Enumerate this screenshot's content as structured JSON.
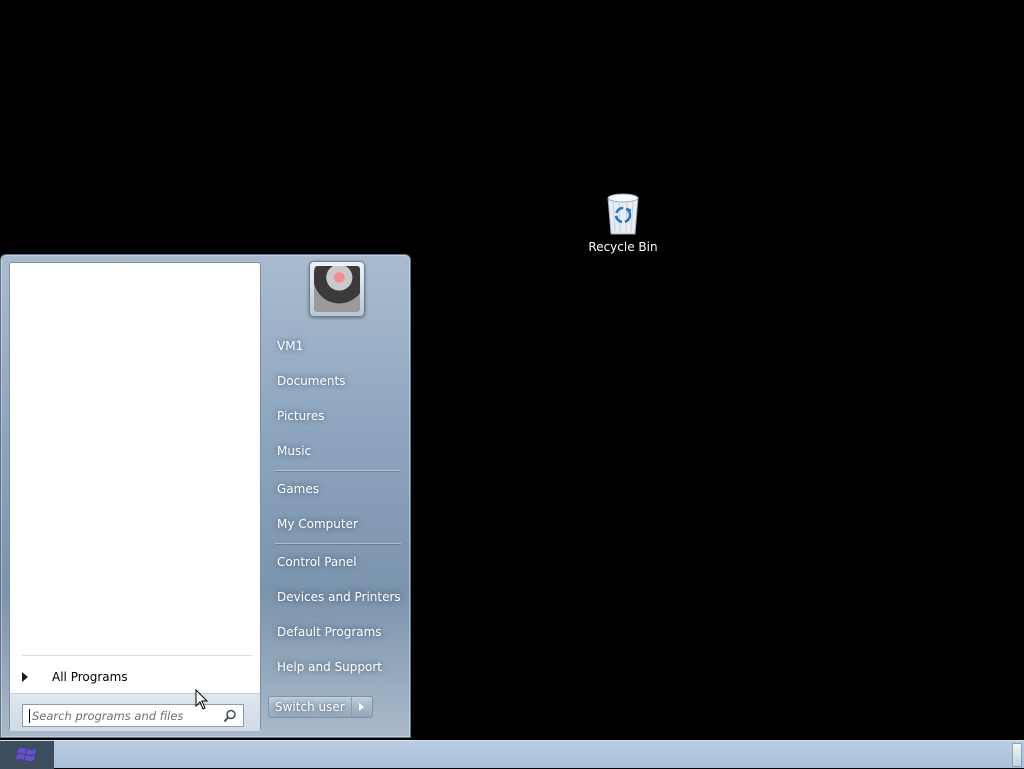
{
  "desktop": {
    "icons": [
      {
        "label": "Recycle Bin",
        "icon": "recycle-bin-icon"
      }
    ]
  },
  "start_menu": {
    "all_programs_label": "All Programs",
    "search_placeholder": "Search programs and files",
    "user_picture": "user-avatar",
    "right_items": [
      {
        "label": "VM1"
      },
      {
        "label": "Documents"
      },
      {
        "label": "Pictures"
      },
      {
        "label": "Music"
      },
      {
        "label": "Games"
      },
      {
        "label": "My Computer"
      },
      {
        "label": "Control Panel"
      },
      {
        "label": "Devices and Printers"
      },
      {
        "label": "Default Programs"
      },
      {
        "label": "Help and Support"
      }
    ],
    "switch_user_label": "Switch user"
  },
  "taskbar": {
    "start_icon": "windows-logo-icon",
    "show_desktop": "show-desktop-button"
  },
  "colors": {
    "desktop_background": "#000000",
    "start_menu_glass": "#8ea6bf",
    "taskbar": "#a8c0da",
    "start_button": "#3c4d5e"
  }
}
